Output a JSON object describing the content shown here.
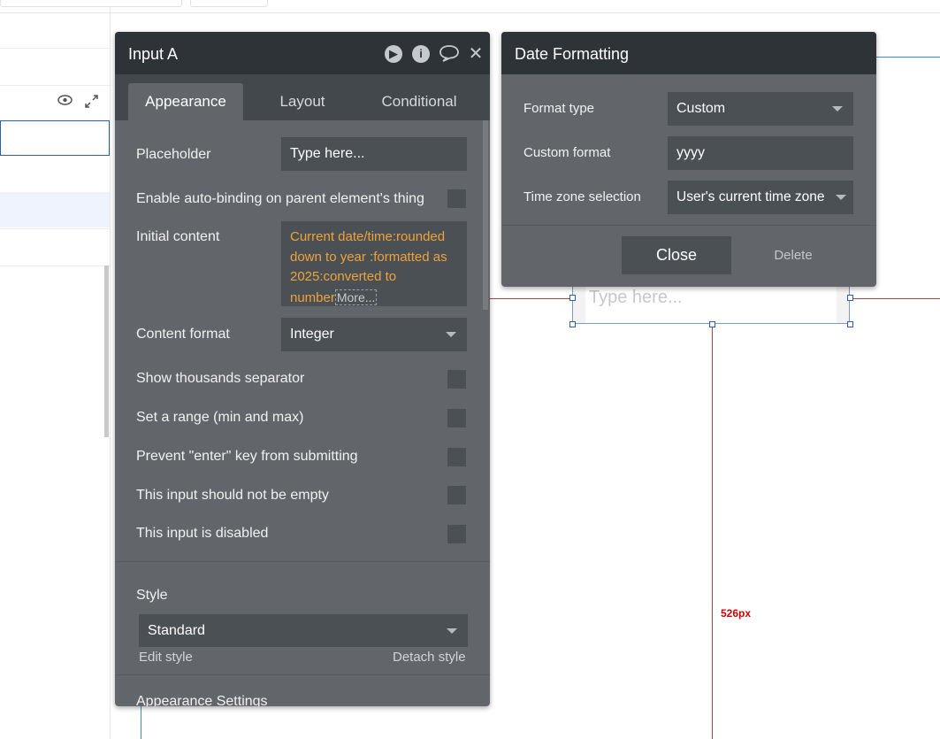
{
  "property_editor": {
    "title": "Input A",
    "tabs": [
      "Appearance",
      "Layout",
      "Conditional"
    ],
    "placeholder_label": "Placeholder",
    "placeholder_value": "Type here...",
    "autobinding_label": "Enable auto-binding on parent element's thing",
    "initial_content_label": "Initial content",
    "initial_content_value": "Current date/time:rounded down to year :formatted as 2025:converted to number",
    "more_label": "More...",
    "content_format_label": "Content format",
    "content_format_value": "Integer",
    "checkboxes": [
      "Show thousands separator",
      "Set a range (min and max)",
      "Prevent \"enter\" key from submitting",
      "This input should not be empty",
      "This input is disabled"
    ],
    "style_label": "Style",
    "style_value": "Standard",
    "edit_style": "Edit style",
    "detach_style": "Detach style",
    "appearance_settings": "Appearance Settings"
  },
  "date_formatting": {
    "title": "Date Formatting",
    "format_type_label": "Format type",
    "format_type_value": "Custom",
    "custom_format_label": "Custom format",
    "custom_format_value": "yyyy",
    "timezone_label": "Time zone selection",
    "timezone_value": "User's current time zone",
    "close": "Close",
    "delete": "Delete"
  },
  "canvas": {
    "input_placeholder": "Type here...",
    "distance_label": "526px"
  },
  "icons": {
    "preview": "eye-icon",
    "expand": "expand-icon",
    "play": "play-icon",
    "info": "info-icon",
    "comment": "comment-icon",
    "close": "close-icon"
  },
  "colors": {
    "panel_header": "#2e3338",
    "panel_body": "#62666b",
    "field_bg": "#4b5055",
    "dynamic_text": "#f0a23a",
    "guide_line": "#c0393b",
    "selection_blue": "#2d5fa8"
  }
}
